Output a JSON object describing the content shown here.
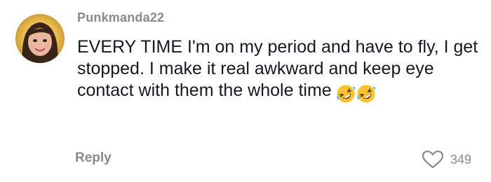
{
  "comment": {
    "username": "Punkmanda22",
    "text": "EVERY TIME I'm on my period and have to fly, I get stopped. I make it real awkward and keep eye contact with them the whole time",
    "emojis": [
      "rolling-on-floor-laughing-emoji",
      "rolling-on-floor-laughing-emoji"
    ],
    "reply_label": "Reply",
    "like_count": "349"
  },
  "colors": {
    "text": "#161823",
    "muted": "#8a8a8a",
    "emoji_face": "#f9c22e"
  }
}
